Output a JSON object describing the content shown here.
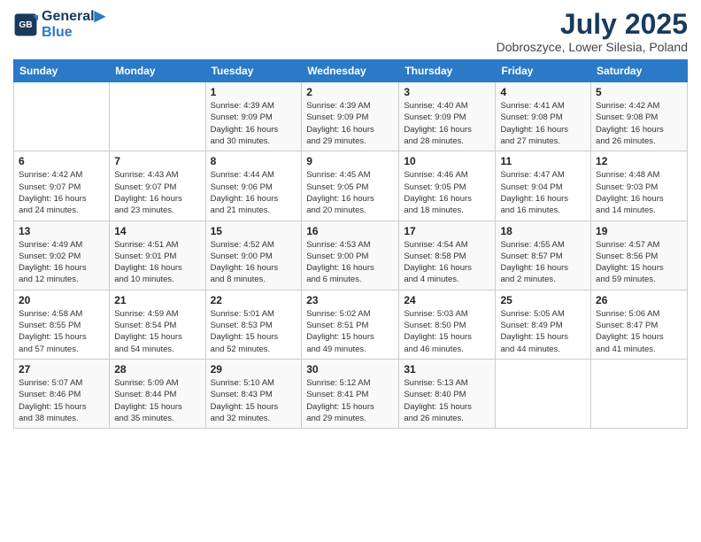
{
  "logo": {
    "line1": "General",
    "line2": "Blue"
  },
  "title": "July 2025",
  "subtitle": "Dobroszyce, Lower Silesia, Poland",
  "days_header": [
    "Sunday",
    "Monday",
    "Tuesday",
    "Wednesday",
    "Thursday",
    "Friday",
    "Saturday"
  ],
  "weeks": [
    [
      {
        "day": "",
        "text": ""
      },
      {
        "day": "",
        "text": ""
      },
      {
        "day": "1",
        "text": "Sunrise: 4:39 AM\nSunset: 9:09 PM\nDaylight: 16 hours\nand 30 minutes."
      },
      {
        "day": "2",
        "text": "Sunrise: 4:39 AM\nSunset: 9:09 PM\nDaylight: 16 hours\nand 29 minutes."
      },
      {
        "day": "3",
        "text": "Sunrise: 4:40 AM\nSunset: 9:09 PM\nDaylight: 16 hours\nand 28 minutes."
      },
      {
        "day": "4",
        "text": "Sunrise: 4:41 AM\nSunset: 9:08 PM\nDaylight: 16 hours\nand 27 minutes."
      },
      {
        "day": "5",
        "text": "Sunrise: 4:42 AM\nSunset: 9:08 PM\nDaylight: 16 hours\nand 26 minutes."
      }
    ],
    [
      {
        "day": "6",
        "text": "Sunrise: 4:42 AM\nSunset: 9:07 PM\nDaylight: 16 hours\nand 24 minutes."
      },
      {
        "day": "7",
        "text": "Sunrise: 4:43 AM\nSunset: 9:07 PM\nDaylight: 16 hours\nand 23 minutes."
      },
      {
        "day": "8",
        "text": "Sunrise: 4:44 AM\nSunset: 9:06 PM\nDaylight: 16 hours\nand 21 minutes."
      },
      {
        "day": "9",
        "text": "Sunrise: 4:45 AM\nSunset: 9:05 PM\nDaylight: 16 hours\nand 20 minutes."
      },
      {
        "day": "10",
        "text": "Sunrise: 4:46 AM\nSunset: 9:05 PM\nDaylight: 16 hours\nand 18 minutes."
      },
      {
        "day": "11",
        "text": "Sunrise: 4:47 AM\nSunset: 9:04 PM\nDaylight: 16 hours\nand 16 minutes."
      },
      {
        "day": "12",
        "text": "Sunrise: 4:48 AM\nSunset: 9:03 PM\nDaylight: 16 hours\nand 14 minutes."
      }
    ],
    [
      {
        "day": "13",
        "text": "Sunrise: 4:49 AM\nSunset: 9:02 PM\nDaylight: 16 hours\nand 12 minutes."
      },
      {
        "day": "14",
        "text": "Sunrise: 4:51 AM\nSunset: 9:01 PM\nDaylight: 16 hours\nand 10 minutes."
      },
      {
        "day": "15",
        "text": "Sunrise: 4:52 AM\nSunset: 9:00 PM\nDaylight: 16 hours\nand 8 minutes."
      },
      {
        "day": "16",
        "text": "Sunrise: 4:53 AM\nSunset: 9:00 PM\nDaylight: 16 hours\nand 6 minutes."
      },
      {
        "day": "17",
        "text": "Sunrise: 4:54 AM\nSunset: 8:58 PM\nDaylight: 16 hours\nand 4 minutes."
      },
      {
        "day": "18",
        "text": "Sunrise: 4:55 AM\nSunset: 8:57 PM\nDaylight: 16 hours\nand 2 minutes."
      },
      {
        "day": "19",
        "text": "Sunrise: 4:57 AM\nSunset: 8:56 PM\nDaylight: 15 hours\nand 59 minutes."
      }
    ],
    [
      {
        "day": "20",
        "text": "Sunrise: 4:58 AM\nSunset: 8:55 PM\nDaylight: 15 hours\nand 57 minutes."
      },
      {
        "day": "21",
        "text": "Sunrise: 4:59 AM\nSunset: 8:54 PM\nDaylight: 15 hours\nand 54 minutes."
      },
      {
        "day": "22",
        "text": "Sunrise: 5:01 AM\nSunset: 8:53 PM\nDaylight: 15 hours\nand 52 minutes."
      },
      {
        "day": "23",
        "text": "Sunrise: 5:02 AM\nSunset: 8:51 PM\nDaylight: 15 hours\nand 49 minutes."
      },
      {
        "day": "24",
        "text": "Sunrise: 5:03 AM\nSunset: 8:50 PM\nDaylight: 15 hours\nand 46 minutes."
      },
      {
        "day": "25",
        "text": "Sunrise: 5:05 AM\nSunset: 8:49 PM\nDaylight: 15 hours\nand 44 minutes."
      },
      {
        "day": "26",
        "text": "Sunrise: 5:06 AM\nSunset: 8:47 PM\nDaylight: 15 hours\nand 41 minutes."
      }
    ],
    [
      {
        "day": "27",
        "text": "Sunrise: 5:07 AM\nSunset: 8:46 PM\nDaylight: 15 hours\nand 38 minutes."
      },
      {
        "day": "28",
        "text": "Sunrise: 5:09 AM\nSunset: 8:44 PM\nDaylight: 15 hours\nand 35 minutes."
      },
      {
        "day": "29",
        "text": "Sunrise: 5:10 AM\nSunset: 8:43 PM\nDaylight: 15 hours\nand 32 minutes."
      },
      {
        "day": "30",
        "text": "Sunrise: 5:12 AM\nSunset: 8:41 PM\nDaylight: 15 hours\nand 29 minutes."
      },
      {
        "day": "31",
        "text": "Sunrise: 5:13 AM\nSunset: 8:40 PM\nDaylight: 15 hours\nand 26 minutes."
      },
      {
        "day": "",
        "text": ""
      },
      {
        "day": "",
        "text": ""
      }
    ]
  ]
}
